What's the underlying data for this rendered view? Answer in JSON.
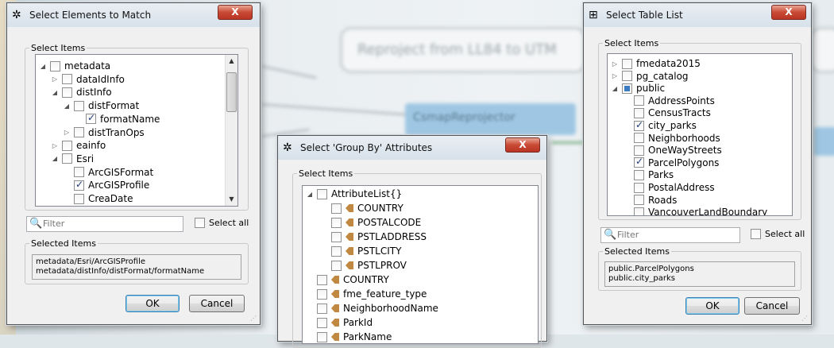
{
  "background": {
    "canvas_label": "Reproject from LL84 to UTM",
    "node_label": "CsmapReprojector"
  },
  "dialog1": {
    "title": "Select Elements to Match",
    "close": "X",
    "group_label": "Select Items",
    "tree": [
      {
        "label": "metadata",
        "arrow": "◢",
        "state": "none",
        "level": 0
      },
      {
        "label": "dataIdInfo",
        "arrow": "▷",
        "state": "none",
        "level": 1
      },
      {
        "label": "distInfo",
        "arrow": "◢",
        "state": "none",
        "level": 1
      },
      {
        "label": "distFormat",
        "arrow": "◢",
        "state": "none",
        "level": 2
      },
      {
        "label": "formatName",
        "arrow": "",
        "state": "checked",
        "level": 3
      },
      {
        "label": "distTranOps",
        "arrow": "▷",
        "state": "none",
        "level": 2
      },
      {
        "label": "eainfo",
        "arrow": "▷",
        "state": "none",
        "level": 1
      },
      {
        "label": "Esri",
        "arrow": "◢",
        "state": "none",
        "level": 1
      },
      {
        "label": "ArcGISFormat",
        "arrow": "",
        "state": "none",
        "level": 2
      },
      {
        "label": "ArcGISProfile",
        "arrow": "",
        "state": "checked",
        "level": 2
      },
      {
        "label": "CreaDate",
        "arrow": "",
        "state": "none",
        "level": 2
      }
    ],
    "filter_placeholder": "Filter",
    "select_all": "Select all",
    "selected_label": "Selected Items",
    "selected": [
      "metadata/Esri/ArcGISProfile",
      "metadata/distInfo/distFormat/formatName"
    ],
    "ok": "OK",
    "cancel": "Cancel"
  },
  "dialog2": {
    "title": "Select 'Group By' Attributes",
    "close": "X",
    "group_label": "Select Items",
    "tree": [
      {
        "label": "AttributeList{}",
        "arrow": "◢",
        "state": "none",
        "level": 0,
        "attr": false
      },
      {
        "label": "COUNTRY",
        "arrow": "",
        "state": "none",
        "level": 1,
        "attr": true
      },
      {
        "label": "POSTALCODE",
        "arrow": "",
        "state": "none",
        "level": 1,
        "attr": true
      },
      {
        "label": "PSTLADDRESS",
        "arrow": "",
        "state": "none",
        "level": 1,
        "attr": true
      },
      {
        "label": "PSTLCITY",
        "arrow": "",
        "state": "none",
        "level": 1,
        "attr": true
      },
      {
        "label": "PSTLPROV",
        "arrow": "",
        "state": "none",
        "level": 1,
        "attr": true
      },
      {
        "label": "COUNTRY",
        "arrow": "",
        "state": "none",
        "level": 0,
        "attr": true
      },
      {
        "label": "fme_feature_type",
        "arrow": "",
        "state": "none",
        "level": 0,
        "attr": true
      },
      {
        "label": "NeighborhoodName",
        "arrow": "",
        "state": "none",
        "level": 0,
        "attr": true
      },
      {
        "label": "ParkId",
        "arrow": "",
        "state": "none",
        "level": 0,
        "attr": true
      },
      {
        "label": "ParkName",
        "arrow": "",
        "state": "none",
        "level": 0,
        "attr": true
      }
    ]
  },
  "dialog3": {
    "title": "Select Table List",
    "close": "X",
    "group_label": "Select Items",
    "tree": [
      {
        "label": "fmedata2015",
        "arrow": "▷",
        "state": "none",
        "level": 0
      },
      {
        "label": "pg_catalog",
        "arrow": "▷",
        "state": "none",
        "level": 0
      },
      {
        "label": "public",
        "arrow": "◢",
        "state": "partial",
        "level": 0
      },
      {
        "label": "AddressPoints",
        "arrow": "",
        "state": "none",
        "level": 1
      },
      {
        "label": "CensusTracts",
        "arrow": "",
        "state": "none",
        "level": 1
      },
      {
        "label": "city_parks",
        "arrow": "",
        "state": "checked",
        "level": 1
      },
      {
        "label": "Neighborhoods",
        "arrow": "",
        "state": "none",
        "level": 1
      },
      {
        "label": "OneWayStreets",
        "arrow": "",
        "state": "none",
        "level": 1
      },
      {
        "label": "ParcelPolygons",
        "arrow": "",
        "state": "checked",
        "level": 1
      },
      {
        "label": "Parks",
        "arrow": "",
        "state": "none",
        "level": 1
      },
      {
        "label": "PostalAddress",
        "arrow": "",
        "state": "none",
        "level": 1
      },
      {
        "label": "Roads",
        "arrow": "",
        "state": "none",
        "level": 1
      },
      {
        "label": "VancouverLandBoundary",
        "arrow": "",
        "state": "none",
        "level": 1
      }
    ],
    "filter_placeholder": "Filter",
    "select_all": "Select all",
    "selected_label": "Selected Items",
    "selected": [
      "public.ParcelPolygons",
      "public.city_parks"
    ],
    "ok": "OK",
    "cancel": "Cancel"
  }
}
